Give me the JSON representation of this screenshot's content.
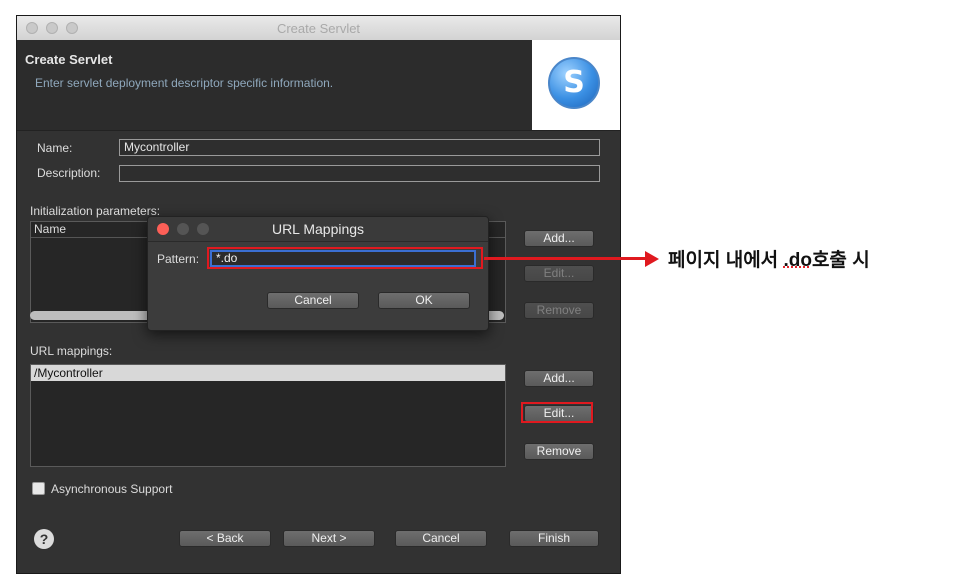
{
  "window": {
    "title": "Create Servlet"
  },
  "header": {
    "title": "Create Servlet",
    "description": "Enter servlet deployment descriptor specific information."
  },
  "form": {
    "name_label": "Name:",
    "name_value": "Mycontroller",
    "description_label": "Description:",
    "description_value": ""
  },
  "init_params": {
    "label": "Initialization parameters:",
    "column": "Name",
    "add": "Add...",
    "edit": "Edit...",
    "remove": "Remove"
  },
  "url_mappings": {
    "label": "URL mappings:",
    "items": [
      "/Mycontroller"
    ],
    "add": "Add...",
    "edit": "Edit...",
    "remove": "Remove"
  },
  "async_label": "Asynchronous Support",
  "footer": {
    "back": "< Back",
    "next": "Next >",
    "cancel": "Cancel",
    "finish": "Finish"
  },
  "dialog": {
    "title": "URL Mappings",
    "pattern_label": "Pattern:",
    "pattern_value": "*.do",
    "cancel": "Cancel",
    "ok": "OK"
  },
  "annotation": {
    "prefix": "페이지 내에서 ",
    "highlight": ".do",
    "suffix": "호출 시"
  },
  "colors": {
    "highlight": "#e0191f",
    "focus": "#3b6fd1"
  },
  "icons": {
    "logo": "servlet-logo-icon",
    "help": "help-icon"
  }
}
